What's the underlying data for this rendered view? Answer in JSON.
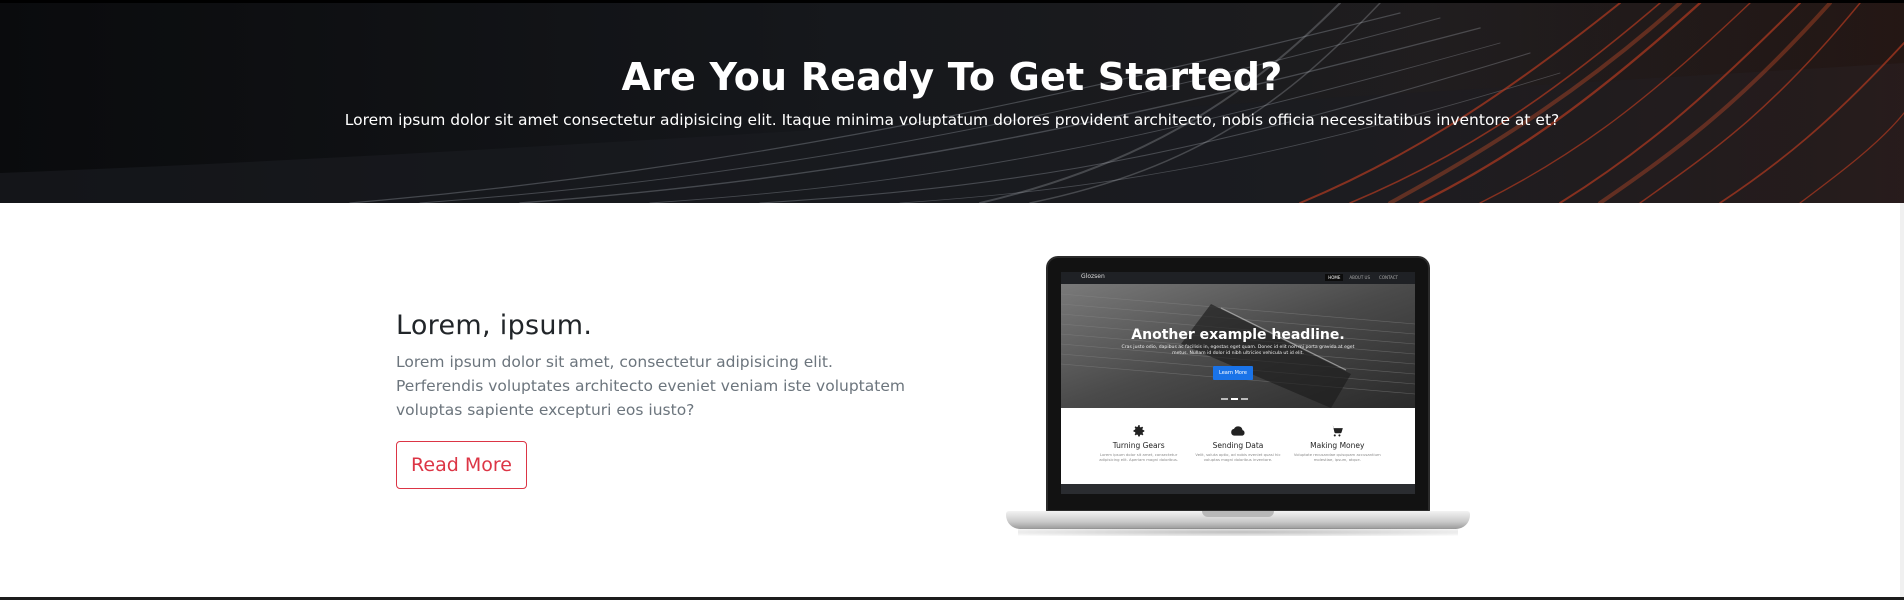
{
  "cta": {
    "title": "Are You Ready To Get Started?",
    "subtitle": "Lorem ipsum dolor sit amet consectetur adipisicing elit. Itaque minima voluptatum dolores provident architecto, nobis officia necessitatibus inventore at et?"
  },
  "feature": {
    "heading": "Lorem, ipsum.",
    "body": "Lorem ipsum dolor sit amet, consectetur adipisicing elit. Perferendis voluptates architecto eveniet veniam iste voluptatem voluptas sapiente excepturi eos iusto?",
    "button_label": "Read More"
  },
  "laptop_screen": {
    "brand": "Glozsen",
    "nav_links": [
      "HOME",
      "ABOUT US",
      "CONTACT"
    ],
    "headline": "Another example headline.",
    "subtext": "Cras justo odio, dapibus ac facilisis in, egestas eget quam. Donec id elit non mi porta gravida at eget metus. Nullam id dolor id nibh ultricies vehicula ut id elit.",
    "button_label": "Learn More",
    "features": [
      {
        "icon": "gear-icon",
        "title": "Turning Gears",
        "text": "Lorem ipsum dolor sit amet, consectetur adipisicing elit. Aperiam magni doloribus."
      },
      {
        "icon": "cloud-icon",
        "title": "Sending Data",
        "text": "Velit, soluta optio, ad nobis eveniet quasi hic voluptas magni doloribus inventore."
      },
      {
        "icon": "cart-icon",
        "title": "Making Money",
        "text": "Voluptate recusandae quisquam accusantium molestiae, ipsum, atque."
      }
    ]
  },
  "colors": {
    "accent": "#dc3545",
    "heading": "#212529",
    "muted": "#6c757d",
    "hero_bg": "#0f1012"
  }
}
